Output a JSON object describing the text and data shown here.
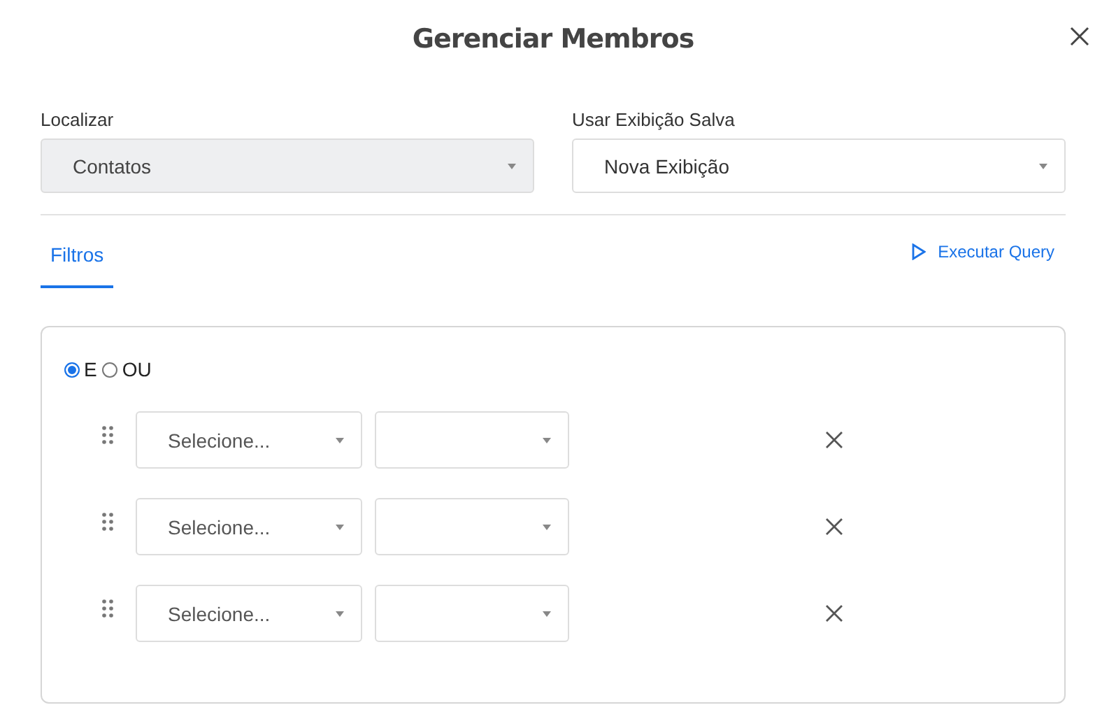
{
  "dialog": {
    "title": "Gerenciar Membros"
  },
  "fields": [
    {
      "label": "Localizar",
      "value": "Contatos",
      "disabled": true
    },
    {
      "label": "Usar Exibição Salva",
      "value": "Nova Exibição",
      "disabled": false
    }
  ],
  "tabs": [
    {
      "label": "Filtros",
      "selected": true
    }
  ],
  "run_button": {
    "label": "Executar Query"
  },
  "logic": [
    {
      "label": "E",
      "selected": true
    },
    {
      "label": "OU",
      "selected": false
    }
  ],
  "filter_rows": [
    {
      "field": {
        "placeholder": "Selecione..."
      }
    },
    {
      "field": {
        "placeholder": "Selecione..."
      }
    },
    {
      "field": {
        "placeholder": "Selecione..."
      }
    }
  ]
}
